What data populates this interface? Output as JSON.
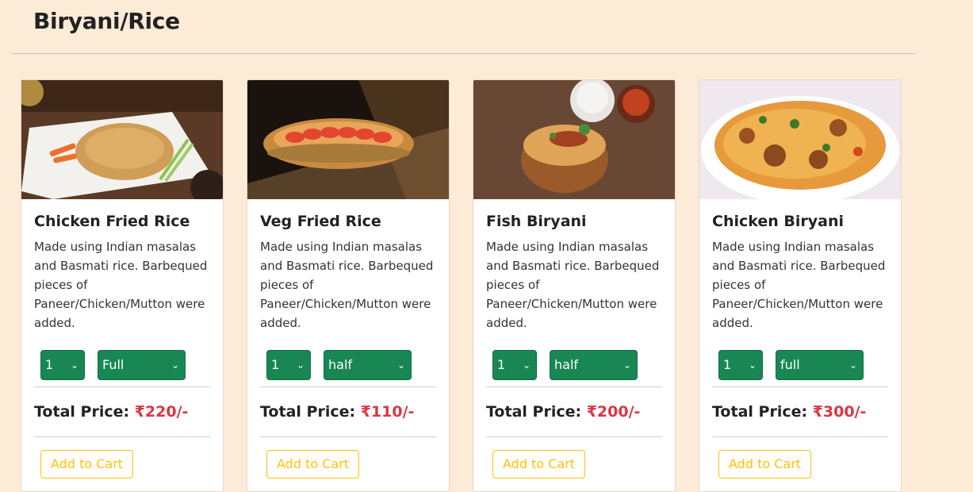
{
  "section": {
    "title": "Biryani/Rice"
  },
  "cards": [
    {
      "title": "Chicken Fried Rice",
      "description": "Made using Indian masalas and Basmati rice. Barbequed pieces of Paneer/Chicken/Mutton were added.",
      "qty": "1",
      "size": "Full",
      "price_label": "Total Price:",
      "price_value": "₹220/-",
      "button": "Add to Cart",
      "image": "chicken-fried-rice-photo"
    },
    {
      "title": "Veg Fried Rice",
      "description": "Made using Indian masalas and Basmati rice. Barbequed pieces of Paneer/Chicken/Mutton were added.",
      "qty": "1",
      "size": "half",
      "price_label": "Total Price:",
      "price_value": "₹110/-",
      "button": "Add to Cart",
      "image": "veg-fried-rice-photo"
    },
    {
      "title": "Fish Biryani",
      "description": "Made using Indian masalas and Basmati rice. Barbequed pieces of Paneer/Chicken/Mutton were added.",
      "qty": "1",
      "size": "half",
      "price_label": "Total Price:",
      "price_value": "₹200/-",
      "button": "Add to Cart",
      "image": "fish-biryani-photo"
    },
    {
      "title": "Chicken Biryani",
      "description": "Made using Indian masalas and Basmati rice. Barbequed pieces of Paneer/Chicken/Mutton were added.",
      "qty": "1",
      "size": "full",
      "price_label": "Total Price:",
      "price_value": "₹300/-",
      "button": "Add to Cart",
      "image": "chicken-biryani-photo"
    }
  ],
  "colors": {
    "background": "#fbebd7",
    "select": "#198754",
    "price": "#dc3545",
    "button": "#ffc107"
  }
}
